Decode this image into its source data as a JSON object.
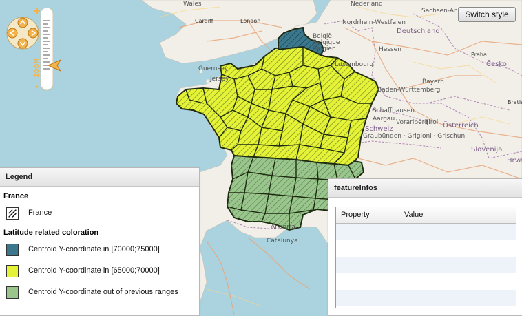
{
  "map_labels": {
    "wales": "Wales",
    "cardiff": "Cardiff",
    "london": "London",
    "nederland": "Nederland",
    "sachsen_anhalt": "Sachsen-Anhalt",
    "belgie": "België",
    "belgique": "Belgique",
    "belgien": "Belgien",
    "nordrhein_westfalen": "Nordrhein-Westfalen",
    "deutschland": "Deutschland",
    "hessen": "Hessen",
    "praha": "Praha",
    "cesko": "Česko",
    "luxembourg": "Luxembourg",
    "guernsey": "Guernsey",
    "jersey": "Jersey",
    "baden_wuerttemberg": "Baden-Württemberg",
    "bayern": "Bayern",
    "bratislava": "Bratis",
    "schaffhausen": "Schaffhausen",
    "aargau": "Aargau",
    "vorarlberg": "Vorarlberg",
    "tirol": "Tirol",
    "osterreich": "Österreich",
    "schweiz": "Schweiz",
    "graubunden": "Graubünden · Grigioni · Grischun",
    "slovenija": "Slovenija",
    "hrvatska": "Hrva",
    "andorra": "Andorra",
    "catalunya": "Catalunya"
  },
  "zoom_control": {
    "label": "ZOOM",
    "level_fraction": 0.7
  },
  "switch_style": {
    "label": "Switch style"
  },
  "legend": {
    "title": "Legend",
    "groups": [
      {
        "title": "France",
        "items": [
          {
            "label": "France",
            "swatch": "hatched",
            "color": "#1a1a1a"
          }
        ]
      },
      {
        "title": "Latitude related coloration",
        "items": [
          {
            "label": "Centroid Y-coordinate in [70000;75000]",
            "color": "#3c788d"
          },
          {
            "label": "Centroid Y-coordinate in [65000;70000]",
            "color": "#e4f238"
          },
          {
            "label": "Centroid Y-coordinate out of previous ranges",
            "color": "#9ac68e"
          }
        ]
      }
    ]
  },
  "feature_infos": {
    "title": "featureInfos",
    "columns": [
      "Property",
      "Value"
    ],
    "rows": [
      [
        "",
        ""
      ],
      [
        "",
        ""
      ],
      [
        "",
        ""
      ],
      [
        "",
        ""
      ],
      [
        "",
        ""
      ]
    ]
  },
  "colors": {
    "sea": "#aad3df",
    "land": "#f2efe9",
    "north": "#3c788d",
    "middle": "#e4f238",
    "south": "#9ac68e",
    "border": "#1e2a10"
  }
}
